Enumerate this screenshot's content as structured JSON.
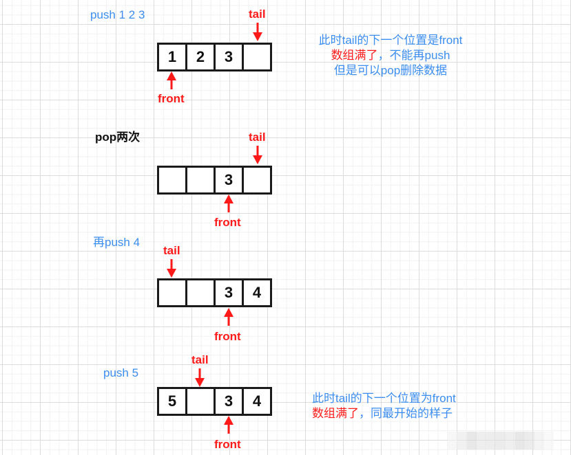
{
  "colors": {
    "blue": "#3b8df0",
    "red": "#ff1a1a",
    "black": "#111111"
  },
  "pointer_labels": {
    "tail": "tail",
    "front": "front"
  },
  "steps": [
    {
      "label": "push 1 2 3",
      "label_color": "blue",
      "cells": [
        "1",
        "2",
        "3",
        ""
      ],
      "tail_index": 4,
      "front_index": 0,
      "note": [
        {
          "segments": [
            {
              "text": "此时tail的下一个位置是front",
              "color": "blue"
            }
          ]
        },
        {
          "segments": [
            {
              "text": "数组满了",
              "color": "red"
            },
            {
              "text": "，不能再push",
              "color": "blue"
            }
          ]
        },
        {
          "segments": [
            {
              "text": "但是可以pop删除数据",
              "color": "blue"
            }
          ]
        }
      ]
    },
    {
      "label": "pop两次",
      "label_color": "black",
      "cells": [
        "",
        "",
        "3",
        ""
      ],
      "tail_index": 4,
      "front_index": 2
    },
    {
      "label": "再push 4",
      "label_color": "blue",
      "cells": [
        "",
        "",
        "3",
        "4"
      ],
      "tail_index": 0,
      "front_index": 2
    },
    {
      "label": "push 5",
      "label_color": "blue",
      "cells": [
        "5",
        "",
        "3",
        "4"
      ],
      "tail_index": 1,
      "front_index": 2,
      "note": [
        {
          "segments": [
            {
              "text": "此时tail的下一个位置为front",
              "color": "blue"
            }
          ]
        },
        {
          "segments": [
            {
              "text": "数组满了",
              "color": "red"
            },
            {
              "text": "，同最开始的样子",
              "color": "blue"
            }
          ]
        }
      ]
    }
  ]
}
